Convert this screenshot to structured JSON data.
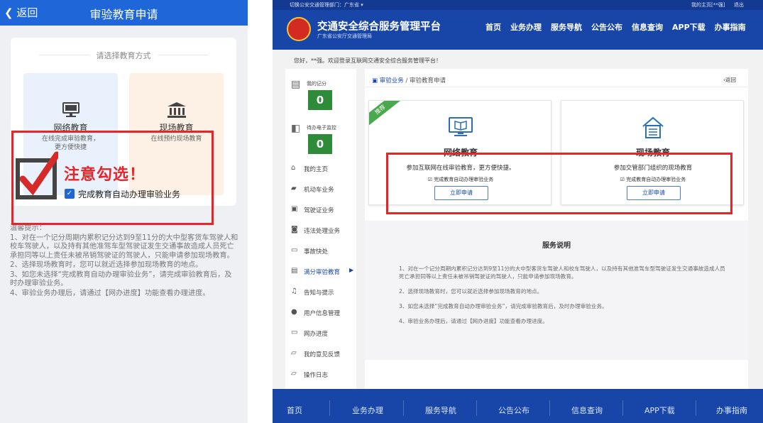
{
  "mobile": {
    "back_label": "返回",
    "title": "审验教育申请",
    "choose_label": "请选择教育方式",
    "options": [
      {
        "name": "网络教育",
        "desc": "在线完成审验教育，\n更方便快捷"
      },
      {
        "name": "现场教育",
        "desc": "在线预约现场教育"
      }
    ],
    "attention": "注意勾选！",
    "auto_label": "完成教育自动办理审验业务",
    "tips_title": "温馨提示：",
    "tips": [
      "1、对在一个记分周期内累积记分达到9至11分的大中型客货车驾驶人和校车驾驶人，以及持有其他准驾车型驾驶证发生交通事故造成人员死亡承担同等以上责任未被吊销驾驶证的驾驶人，只能申请参加现场教育。",
      "2、选择现场教育时，您可以就近选择参加现场教育的地点。",
      "3、如您未选择“完成教育自动办理审验业务”，请完成审验教育后，及时办理审验业务。",
      "4、审验业务办理后，请通过【网办进度】功能查看办理进度。"
    ]
  },
  "web": {
    "topbar": {
      "switch": "切换公安交通管理部门：广东省 ▾",
      "myhome": "我的主页[**强]",
      "exit": "退出"
    },
    "title": "交通安全综合服务管理平台",
    "subtitle": "广东省公安厅交通管理局",
    "nav": [
      "首页",
      "业务办理",
      "服务导航",
      "公告公布",
      "信息查询",
      "APP下载",
      "办事指南"
    ],
    "greeting": "您好，**强。欢迎登录互联网交通安全综合服务管理平台！",
    "sidebar": {
      "stats": [
        {
          "label": "我的记分",
          "value": "0"
        },
        {
          "label": "待办电子监控",
          "value": "0"
        }
      ],
      "items": [
        "我的主页",
        "机动车业务",
        "驾驶证业务",
        "违法处理业务",
        "事故快处",
        "满分审验教育",
        "告知与提示",
        "用户信息管理",
        "网办进度",
        "我的意见反馈",
        "操作日志"
      ]
    },
    "breadcrumb": {
      "root": "审验业务",
      "current": "审验教育申请",
      "back": "返回"
    },
    "cards": [
      {
        "badge": "推荐",
        "name": "网络教育",
        "desc": "参加互联网在线审验教育，更方便快捷。",
        "check": "完成教育自动办理审验业务",
        "button": "立即申请"
      },
      {
        "name": "现场教育",
        "desc": "参加交管部门组织的现场教育",
        "check": "完成教育自动办理审验业务",
        "button": "立即申请"
      }
    ],
    "service": {
      "title": "服务说明",
      "items": [
        "1、对在一个记分周期内累积记分达到9至11分的大中型客货车驾驶人和校车驾驶人，以及持有其他准驾车型驾驶证发生交通事故造成人员死亡承担同等以上责任未被吊销驾驶证的驾驶人，只能申请参加现场教育。",
        "2、选择现场教育时，您可以就近选择参加现场教育的地点。",
        "3、如您未选择“完成教育自动办理审验业务”，请完成审验教育后，及时办理审验业务。",
        "4、审验业务办理后，请通过【网办进度】功能查看办理进度。"
      ]
    },
    "footer": [
      "首页",
      "业务办理",
      "服务导航",
      "公告公布",
      "信息查询",
      "APP下载",
      "办事指南"
    ]
  }
}
